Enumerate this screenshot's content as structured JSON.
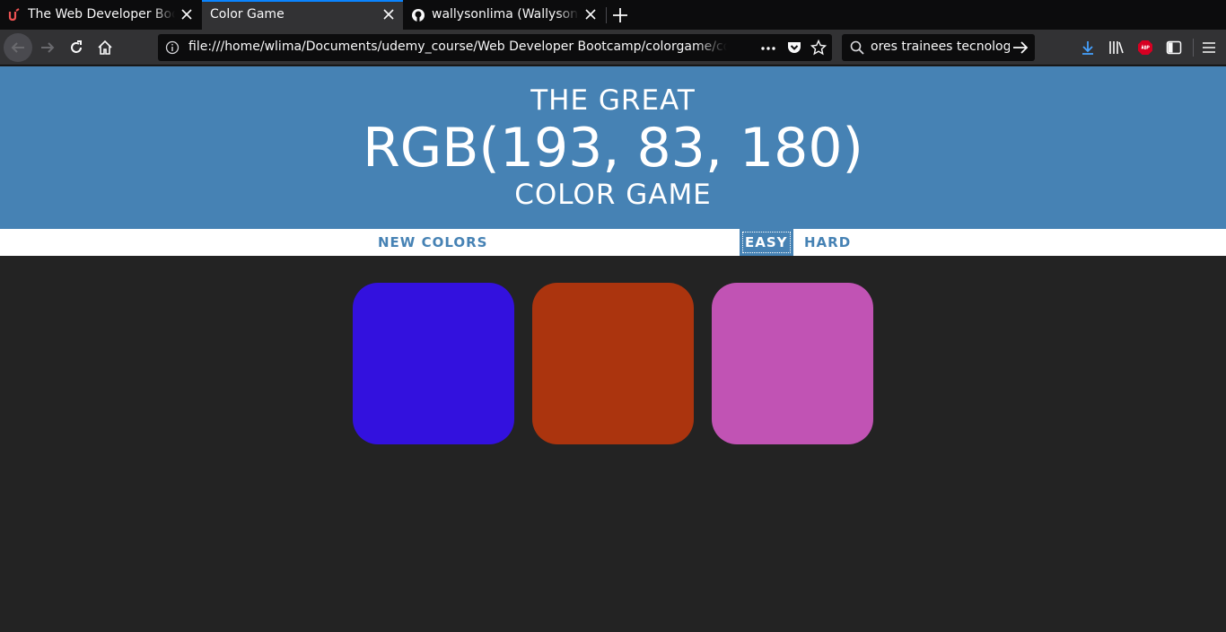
{
  "browser": {
    "tabs": [
      {
        "title": "The Web Developer Bootcamp",
        "favicon": "udemy-icon",
        "active": false
      },
      {
        "title": "Color Game",
        "favicon": "none",
        "active": true
      },
      {
        "title": "wallysonlima (Wallyson Lima)",
        "favicon": "github-icon",
        "active": false
      }
    ],
    "url": "file:///home/wlima/Documents/udemy_course/Web Developer Bootcamp/colorgame/colorgame.html",
    "search_text": "ores trainees tecnologia",
    "accent_color": "#0a84ff"
  },
  "game": {
    "header": {
      "line1": "The Great",
      "target_color": "RGB(193, 83, 180)",
      "line3": "Color Game",
      "background": "#4682b4"
    },
    "controls": {
      "new_colors": "New Colors",
      "easy": "Easy",
      "hard": "Hard",
      "selected_mode": "Easy"
    },
    "squares": [
      {
        "color": "rgb(51, 17, 222)"
      },
      {
        "color": "rgb(171, 52, 14)"
      },
      {
        "color": "rgb(193, 83, 180)"
      }
    ],
    "body_background": "#232323"
  }
}
